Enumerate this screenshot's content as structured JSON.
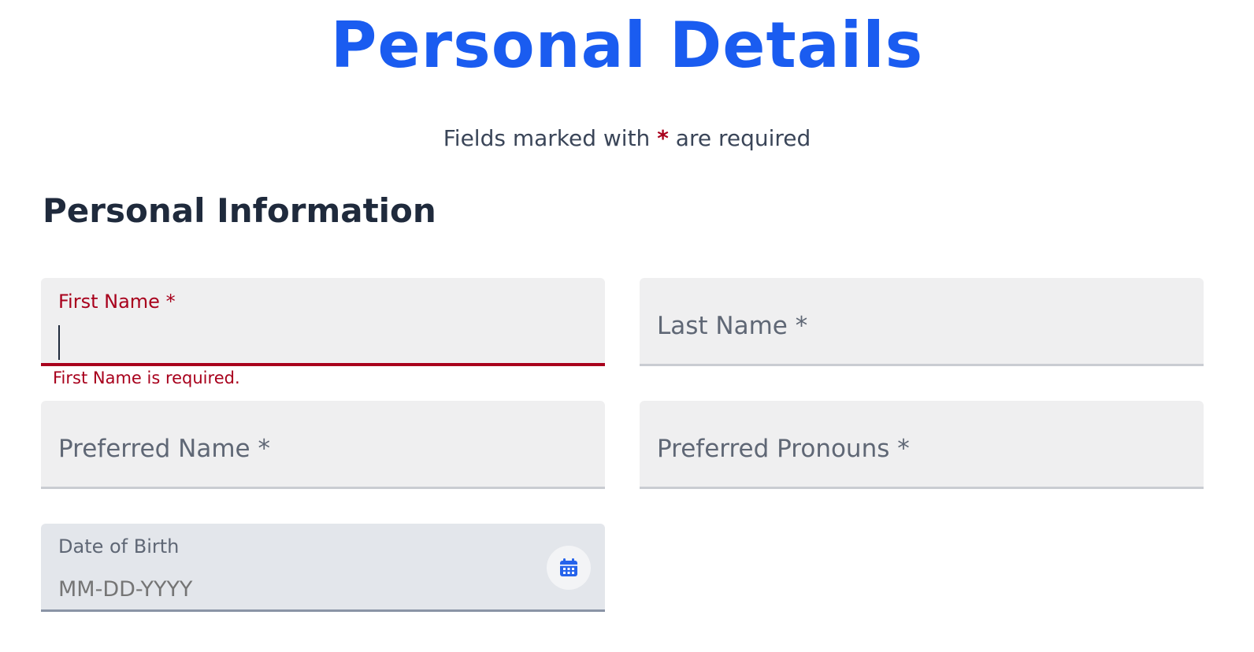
{
  "page_title": "Personal Details",
  "required_note": {
    "before": "Fields marked with",
    "star": "*",
    "after": "are required"
  },
  "section_heading": "Personal Information",
  "fields": {
    "first_name": {
      "label": "First Name *",
      "value": "",
      "error": "First Name is required."
    },
    "last_name": {
      "label": "Last Name *"
    },
    "preferred_name": {
      "label": "Preferred Name *"
    },
    "preferred_pronouns": {
      "label": "Preferred Pronouns *"
    },
    "date_of_birth": {
      "label": "Date of Birth",
      "placeholder": "MM-DD-YYYY",
      "icon": "calendar-icon"
    }
  },
  "colors": {
    "title": "#1a5cf0",
    "error": "#a8001c",
    "heading": "#1f2a3c",
    "calendar_icon": "#2563eb"
  }
}
